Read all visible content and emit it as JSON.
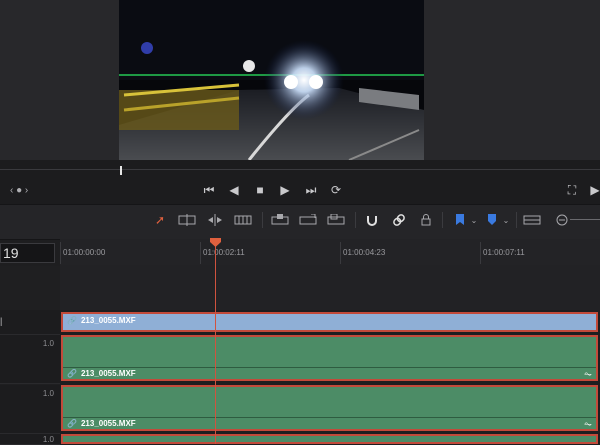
{
  "viewer": {
    "nav_left": "‹ ● ›"
  },
  "timeline": {
    "timecode": "19",
    "ruler": [
      "01:00:00:00",
      "01:00:02:11",
      "01:00:04:23",
      "01:00:07:11"
    ]
  },
  "tracks": {
    "video_clip": "213_0055.MXF",
    "audio": [
      {
        "level": "1.0",
        "clip": "213_0055.MXF"
      },
      {
        "level": "1.0",
        "clip": "213_0055.MXF"
      },
      {
        "level": "1.0",
        "clip": ""
      }
    ]
  },
  "colors": {
    "video_clip": "#8fafd6",
    "audio_clip": "#4c8c66",
    "playhead": "#d0533f",
    "selection_border": "#c24a3a"
  }
}
